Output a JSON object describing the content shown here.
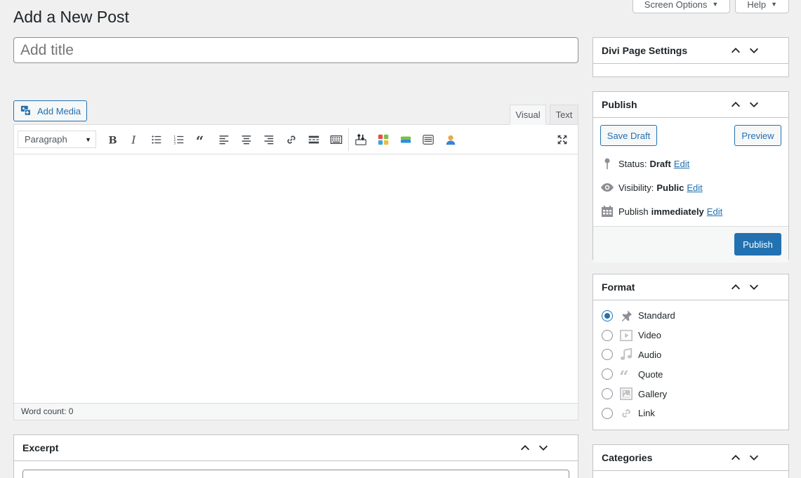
{
  "header": {
    "page_title": "Add a New Post",
    "screen_options_label": "Screen Options",
    "help_label": "Help"
  },
  "title_field": {
    "placeholder": "Add title",
    "value": ""
  },
  "editor": {
    "add_media_label": "Add Media",
    "tabs": [
      {
        "label": "Visual",
        "active": true
      },
      {
        "label": "Text",
        "active": false
      }
    ],
    "format_select": {
      "selected": "Paragraph"
    },
    "toolbar_icons": [
      "bold-icon",
      "italic-icon",
      "bulleted-list-icon",
      "numbered-list-icon",
      "blockquote-icon",
      "align-left-icon",
      "align-center-icon",
      "align-right-icon",
      "insert-link-icon",
      "read-more-icon",
      "toolbar-toggle-icon",
      "divi-shortcode-icon",
      "divi-layout-icon",
      "divi-button-icon",
      "divi-box-icon",
      "divi-person-icon",
      "fullscreen-icon"
    ],
    "word_count": "Word count: 0"
  },
  "excerpt": {
    "title": "Excerpt"
  },
  "divi_settings": {
    "title": "Divi Page Settings"
  },
  "publish": {
    "title": "Publish",
    "save_draft_label": "Save Draft",
    "preview_label": "Preview",
    "status_label": "Status:",
    "status_value": "Draft",
    "visibility_label": "Visibility:",
    "visibility_value": "Public",
    "schedule_label": "Publish",
    "schedule_value": "immediately",
    "edit_label": "Edit",
    "publish_button": "Publish"
  },
  "format": {
    "title": "Format",
    "options": [
      {
        "label": "Standard",
        "icon": "pin-icon",
        "checked": true
      },
      {
        "label": "Video",
        "icon": "video-icon",
        "checked": false
      },
      {
        "label": "Audio",
        "icon": "audio-icon",
        "checked": false
      },
      {
        "label": "Quote",
        "icon": "quote-icon",
        "checked": false
      },
      {
        "label": "Gallery",
        "icon": "gallery-icon",
        "checked": false
      },
      {
        "label": "Link",
        "icon": "link-icon",
        "checked": false
      }
    ]
  },
  "categories": {
    "title": "Categories"
  },
  "colors": {
    "accent": "#2271b1",
    "background": "#f0f0f1",
    "border": "#c3c4c7"
  }
}
